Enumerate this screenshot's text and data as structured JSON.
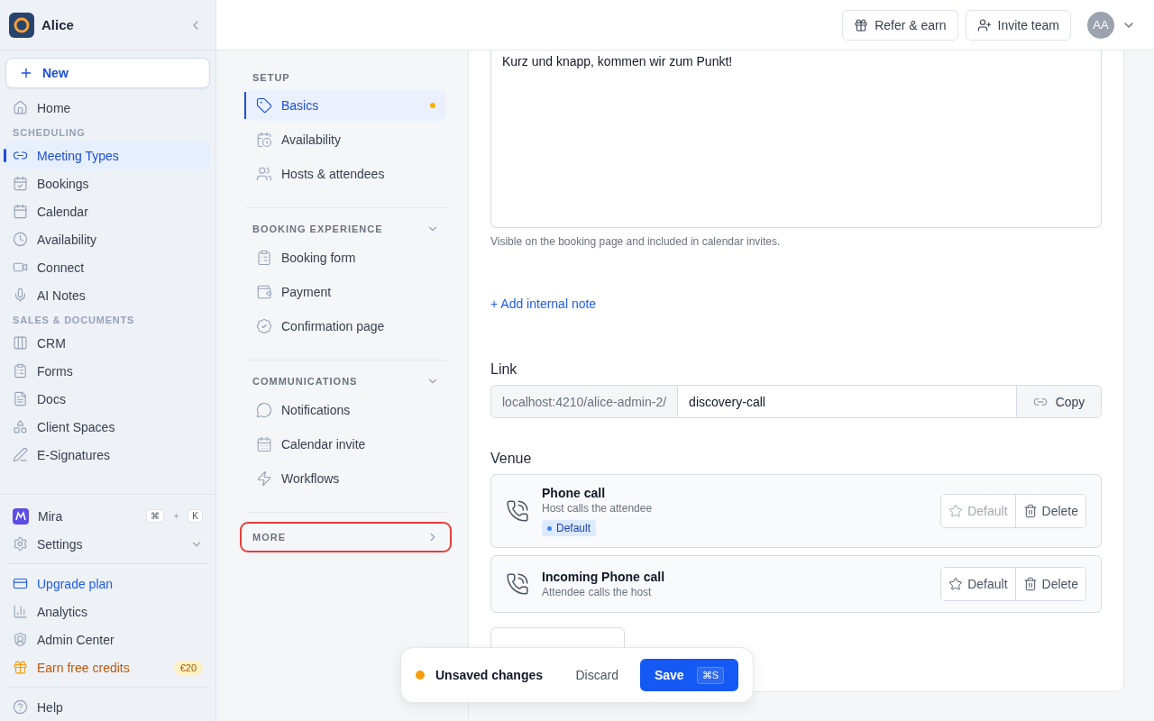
{
  "sidebar": {
    "workspace": "Alice",
    "new_button": "New",
    "top_items": [
      {
        "label": "Home",
        "selected": false
      }
    ],
    "sections": [
      {
        "title": "SCHEDULING",
        "items": [
          {
            "label": "Meeting Types",
            "selected": true
          },
          {
            "label": "Bookings",
            "selected": false
          },
          {
            "label": "Calendar",
            "selected": false
          },
          {
            "label": "Availability",
            "selected": false
          },
          {
            "label": "Connect",
            "selected": false
          },
          {
            "label": "AI Notes",
            "selected": false
          }
        ]
      },
      {
        "title": "SALES & DOCUMENTS",
        "items": [
          {
            "label": "CRM",
            "selected": false
          },
          {
            "label": "Forms",
            "selected": false
          },
          {
            "label": "Docs",
            "selected": false
          },
          {
            "label": "Client Spaces",
            "selected": false
          },
          {
            "label": "E-Signatures",
            "selected": false
          }
        ]
      }
    ],
    "assistant": {
      "label": "Mira",
      "keys": [
        "⌘",
        "+",
        "K"
      ]
    },
    "settings": {
      "label": "Settings",
      "expanded": false
    },
    "footer_items": [
      {
        "kind": "upgrade",
        "label": "Upgrade plan"
      },
      {
        "kind": "plain",
        "label": "Analytics"
      },
      {
        "kind": "plain",
        "label": "Admin Center"
      },
      {
        "kind": "credits",
        "label": "Earn free credits",
        "badge": "€20"
      }
    ],
    "help": "Help"
  },
  "topbar": {
    "buttons": [
      "Refer & earn",
      "Invite team"
    ],
    "avatar": "AA"
  },
  "subnav": {
    "groups": [
      {
        "title": "SETUP",
        "collapsible": false,
        "items": [
          {
            "label": "Basics",
            "selected": true,
            "unsaved": true
          },
          {
            "label": "Availability",
            "selected": false,
            "unsaved": false
          },
          {
            "label": "Hosts & attendees",
            "selected": false,
            "unsaved": false
          }
        ]
      },
      {
        "title": "BOOKING EXPERIENCE",
        "collapsible": true,
        "expanded": true,
        "items": [
          {
            "label": "Booking form",
            "selected": false,
            "unsaved": false
          },
          {
            "label": "Payment",
            "selected": false,
            "unsaved": false
          },
          {
            "label": "Confirmation page",
            "selected": false,
            "unsaved": false
          }
        ]
      },
      {
        "title": "COMMUNICATIONS",
        "collapsible": true,
        "expanded": true,
        "items": [
          {
            "label": "Notifications",
            "selected": false,
            "unsaved": false
          },
          {
            "label": "Calendar invite",
            "selected": false,
            "unsaved": false
          },
          {
            "label": "Workflows",
            "selected": false,
            "unsaved": false
          }
        ]
      }
    ],
    "more": {
      "label": "MORE",
      "highlighted": true
    }
  },
  "content": {
    "description": "Kurz und knapp, kommen wir zum Punkt!",
    "hint": "Visible on the booking page and included in calendar invites.",
    "add_note": "+ Add internal note",
    "link": {
      "label": "Link",
      "prefix": "localhost:4210/alice-admin-2/",
      "slug": "discovery-call",
      "copy": "Copy"
    },
    "venue": {
      "label": "Venue",
      "items": [
        {
          "title": "Phone call",
          "subtitle": "Host calls the attendee",
          "is_default": true,
          "badge": "Default",
          "default_button": "Default",
          "delete_button": "Delete"
        },
        {
          "title": "Incoming Phone call",
          "subtitle": "Attendee calls the host",
          "is_default": false,
          "default_button": "Default",
          "delete_button": "Delete"
        }
      ]
    }
  },
  "toast": {
    "status": "Unsaved changes",
    "discard": "Discard",
    "save": "Save",
    "shortcut": "⌘S"
  }
}
